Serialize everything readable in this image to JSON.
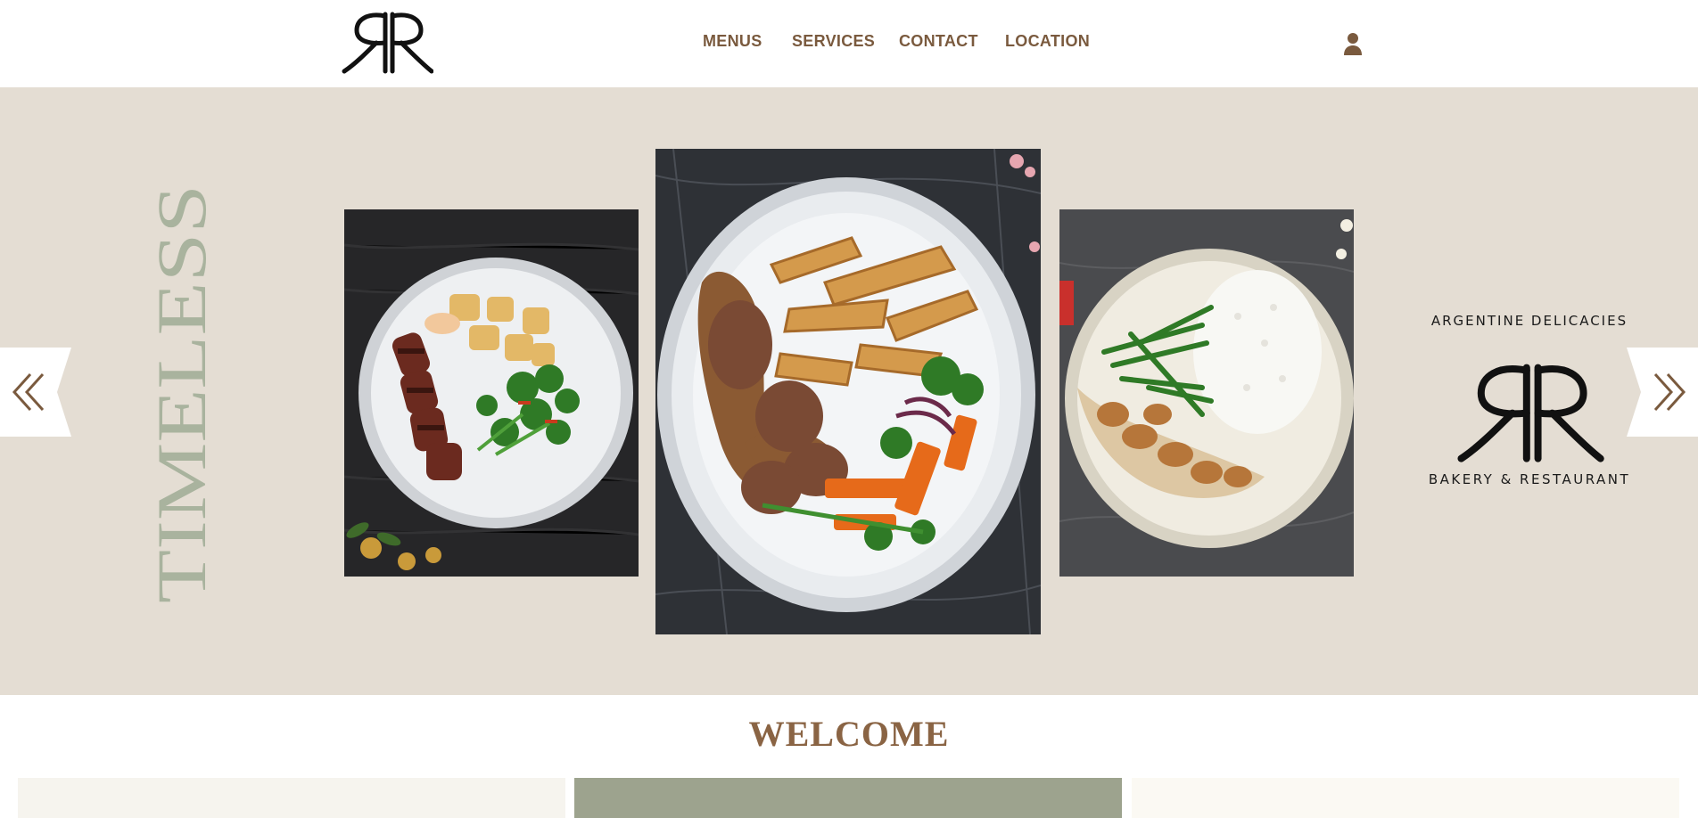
{
  "header": {
    "logo_alt": "RR",
    "nav": {
      "menus": "MENUS",
      "services": "SERVICES",
      "contact": "CONTACT",
      "location": "LOCATION"
    },
    "user_icon": "user-icon"
  },
  "hero": {
    "vertical_title": "TIMELESS",
    "photos": [
      "steak-with-potatoes-and-broccolini",
      "steak-with-potato-wedges-and-gravy",
      "chicken-with-rice-and-green-beans"
    ],
    "prev_icon": "double-chevron-left-icon",
    "next_icon": "double-chevron-right-icon",
    "badge": {
      "title": "ARGENTINE DELICACIES",
      "logo": "RR",
      "subtitle": "BAKERY & RESTAURANT"
    }
  },
  "welcome": {
    "heading": "WELCOME"
  },
  "colors": {
    "brand_brown": "#7a5a3e",
    "hero_bg": "#e4ddd3",
    "sage": "#9da38e",
    "timeless_text": "#a9b39e"
  }
}
